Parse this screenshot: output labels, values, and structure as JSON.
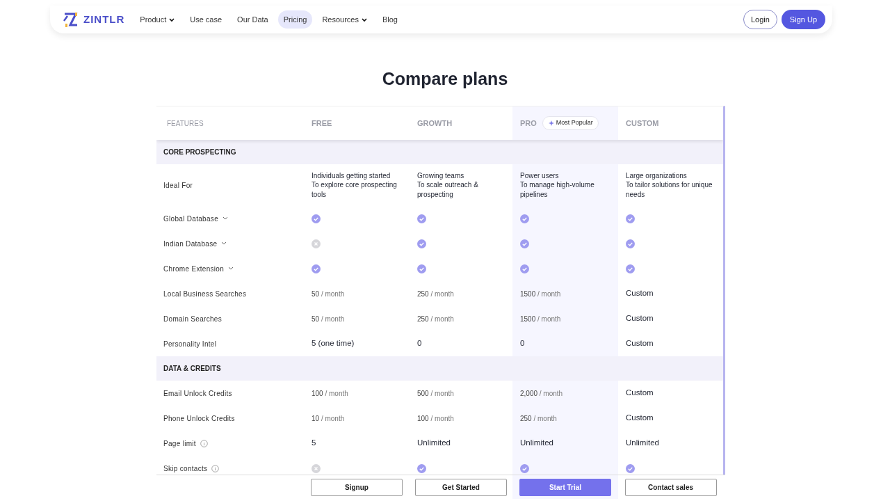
{
  "nav": {
    "brand": "ZINTLR",
    "items": [
      {
        "label": "Product",
        "dropdown": true,
        "selected": false
      },
      {
        "label": "Use case",
        "dropdown": false,
        "selected": false
      },
      {
        "label": "Our Data",
        "dropdown": false,
        "selected": false
      },
      {
        "label": "Pricing",
        "dropdown": false,
        "selected": true
      },
      {
        "label": "Resources",
        "dropdown": true,
        "selected": false
      },
      {
        "label": "Blog",
        "dropdown": false,
        "selected": false
      }
    ],
    "login": "Login",
    "signup": "Sign Up"
  },
  "title": "Compare plans",
  "columns": [
    {
      "label": "FEATURES"
    },
    {
      "label": "FREE"
    },
    {
      "label": "GROWTH"
    },
    {
      "label": "PRO",
      "badge": "Most Popular",
      "highlighted": true
    },
    {
      "label": "CUSTOM"
    }
  ],
  "sections": [
    {
      "title": "CORE PROSPECTING",
      "rows": [
        {
          "feature": "Ideal For",
          "kind": "lines",
          "cells": [
            [
              "Individuals getting started",
              "To explore core prospecting tools"
            ],
            [
              "Growing teams",
              "To scale outreach & prospecting"
            ],
            [
              "Power users",
              "To manage high-volume pipelines"
            ],
            [
              "Large organizations",
              "To tailor solutions for unique needs"
            ]
          ]
        },
        {
          "feature": "Global Database",
          "expandable": true,
          "kind": "check",
          "cells": [
            true,
            true,
            true,
            true
          ]
        },
        {
          "feature": "Indian Database",
          "expandable": true,
          "kind": "check",
          "cells": [
            false,
            true,
            true,
            true
          ]
        },
        {
          "feature": "Chrome Extension",
          "expandable": true,
          "kind": "check",
          "cells": [
            true,
            true,
            true,
            true
          ]
        },
        {
          "feature": "Local Business Searches",
          "kind": "quota",
          "cells": [
            {
              "value": "50",
              "unit": "/ month"
            },
            {
              "value": "250",
              "unit": "/ month"
            },
            {
              "value": "1500",
              "unit": "/ month"
            },
            {
              "value": "Custom"
            }
          ]
        },
        {
          "feature": "Domain Searches",
          "kind": "quota",
          "cells": [
            {
              "value": "50",
              "unit": "/ month"
            },
            {
              "value": "250",
              "unit": "/ month"
            },
            {
              "value": "1500",
              "unit": "/ month"
            },
            {
              "value": "Custom"
            }
          ]
        },
        {
          "feature": "Personality Intel",
          "kind": "text",
          "cells": [
            "5 (one time)",
            "0",
            "0",
            "Custom"
          ]
        }
      ]
    },
    {
      "title": "DATA & CREDITS",
      "rows": [
        {
          "feature": "Email Unlock Credits",
          "kind": "quota",
          "cells": [
            {
              "value": "100",
              "unit": "/ month"
            },
            {
              "value": "500",
              "unit": "/ month"
            },
            {
              "value": "2,000",
              "unit": "/ month"
            },
            {
              "value": "Custom"
            }
          ]
        },
        {
          "feature": "Phone Unlock Credits",
          "kind": "quota",
          "cells": [
            {
              "value": "10",
              "unit": "/ month"
            },
            {
              "value": "100",
              "unit": "/ month"
            },
            {
              "value": "250",
              "unit": "/ month"
            },
            {
              "value": "Custom"
            }
          ]
        },
        {
          "feature": "Page limit",
          "info": true,
          "kind": "text",
          "cells": [
            "5",
            "Unlimited",
            "Unlimited",
            "Unlimited"
          ]
        },
        {
          "feature": "Skip contacts",
          "info": true,
          "kind": "check",
          "cells": [
            false,
            true,
            true,
            true
          ]
        }
      ]
    }
  ],
  "actions": [
    {
      "label": "Signup",
      "primary": false
    },
    {
      "label": "Get Started",
      "primary": false
    },
    {
      "label": "Start Trial",
      "primary": true
    },
    {
      "label": "Contact sales",
      "primary": false
    }
  ]
}
